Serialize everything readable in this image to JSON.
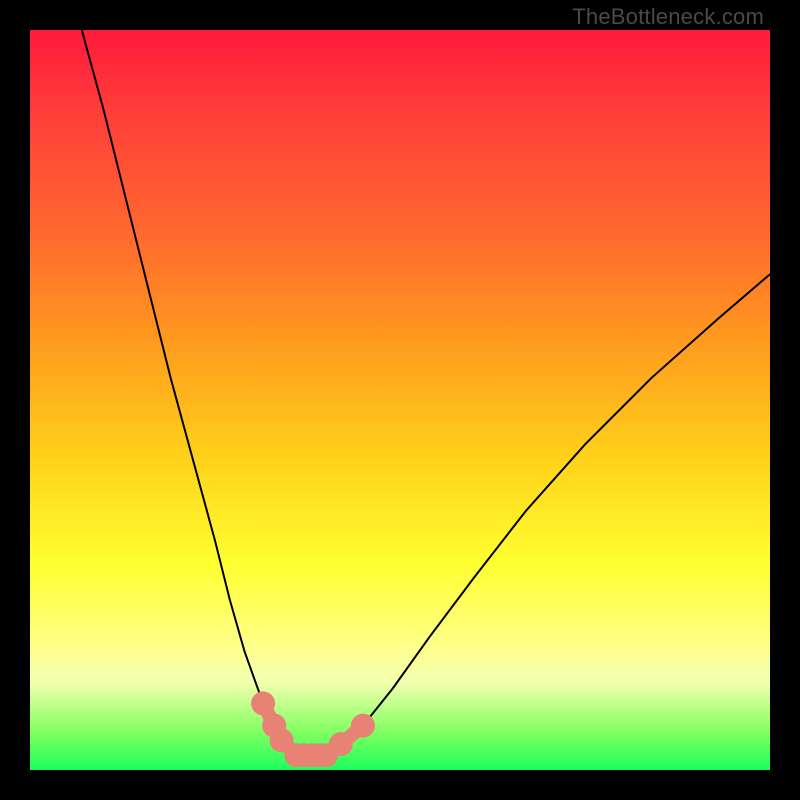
{
  "watermark": "TheBottleneck.com",
  "chart_data": {
    "type": "line",
    "title": "",
    "xlabel": "",
    "ylabel": "",
    "xlim": [
      0,
      100
    ],
    "ylim": [
      0,
      100
    ],
    "series": [
      {
        "name": "left-curve",
        "x": [
          7,
          10,
          13,
          16,
          19,
          22,
          25,
          27,
          29,
          31.5,
          33,
          34,
          35,
          36
        ],
        "y": [
          100,
          89,
          77,
          65,
          53,
          42,
          31,
          23,
          16,
          9,
          6,
          4,
          2.5,
          2
        ]
      },
      {
        "name": "right-curve",
        "x": [
          40,
          42,
          45,
          49,
          54,
          60,
          67,
          75,
          84,
          93,
          100
        ],
        "y": [
          2,
          3.5,
          6,
          11,
          18,
          26,
          35,
          44,
          53,
          61,
          67
        ]
      }
    ],
    "markers": {
      "name": "highlight-dots",
      "x": [
        31.5,
        33,
        34,
        36,
        37,
        38,
        39,
        40,
        42,
        45
      ],
      "y": [
        9,
        6,
        4,
        2,
        2,
        2,
        2,
        2,
        3.5,
        6
      ],
      "color": "#e88274",
      "radius": 12
    },
    "background_gradient": {
      "top": "#ff1a3c",
      "bottom": "#1aff5a",
      "stops": [
        "red",
        "orange",
        "yellow",
        "pale-yellow",
        "green"
      ]
    }
  }
}
